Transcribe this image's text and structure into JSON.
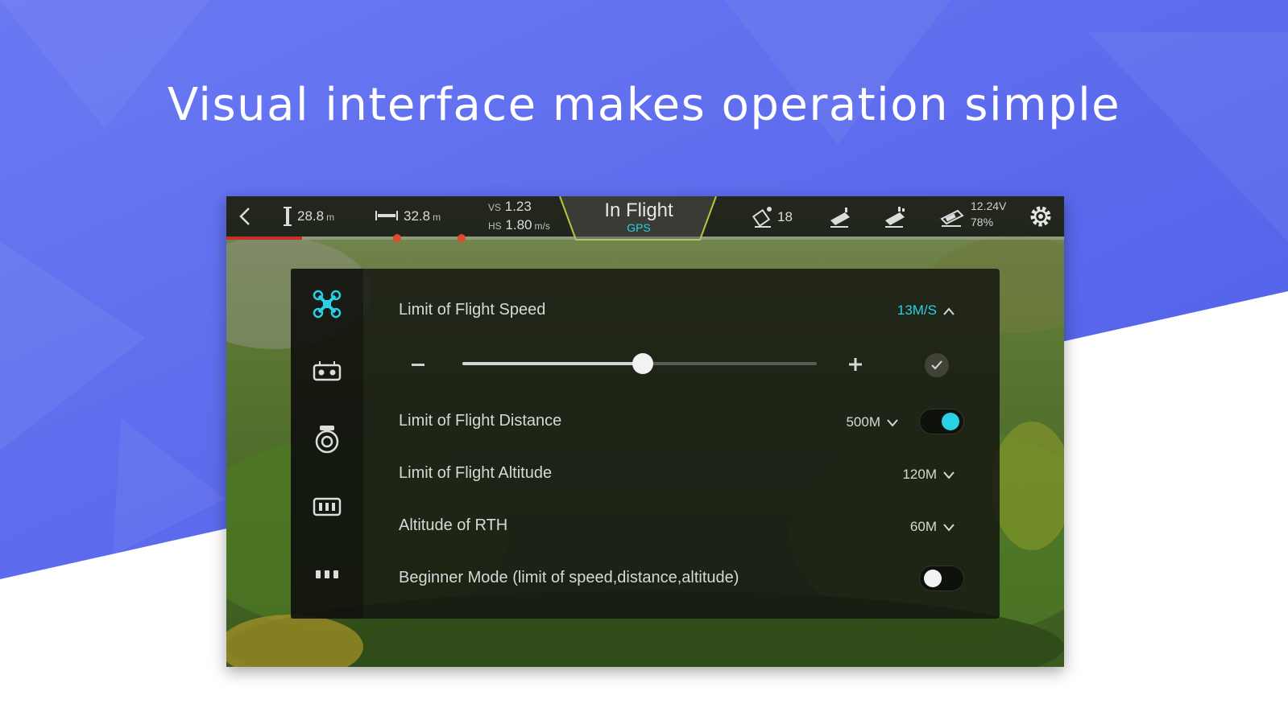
{
  "promo": {
    "headline": "Visual interface makes operation simple",
    "colors": {
      "background": "#5b6af0",
      "accent": "#2ad0e6"
    }
  },
  "app": {
    "topbar": {
      "height": {
        "value": "28.8",
        "unit": "m"
      },
      "distance": {
        "value": "32.8",
        "unit": "m"
      },
      "vertical_speed": {
        "prefix": "VS",
        "value": "1.23"
      },
      "horizontal_speed": {
        "prefix": "HS",
        "value": "1.80",
        "unit": "m/s"
      },
      "status": {
        "title": "In Flight",
        "subtitle": "GPS"
      },
      "satellites": "18",
      "battery": {
        "voltage": "12.24V",
        "percent": "78%"
      },
      "mission_progress": 0.09
    },
    "settings": {
      "sidebar": [
        {
          "icon": "drone-icon",
          "active": true
        },
        {
          "icon": "remote-controller-icon",
          "active": false
        },
        {
          "icon": "camera-icon",
          "active": false
        },
        {
          "icon": "battery-icon",
          "active": false
        },
        {
          "icon": "more-icon",
          "active": false
        }
      ],
      "flight_speed": {
        "label": "Limit of Flight Speed",
        "value": "13M/S",
        "slider": 0.51
      },
      "flight_distance": {
        "label": "Limit of Flight Distance",
        "value": "500M",
        "enabled": true
      },
      "flight_altitude": {
        "label": "Limit of Flight Altitude",
        "value": "120M"
      },
      "rth_altitude": {
        "label": "Altitude of RTH",
        "value": "60M"
      },
      "beginner_mode": {
        "label": "Beginner Mode (limit of speed,distance,altitude)",
        "enabled": false
      }
    }
  }
}
